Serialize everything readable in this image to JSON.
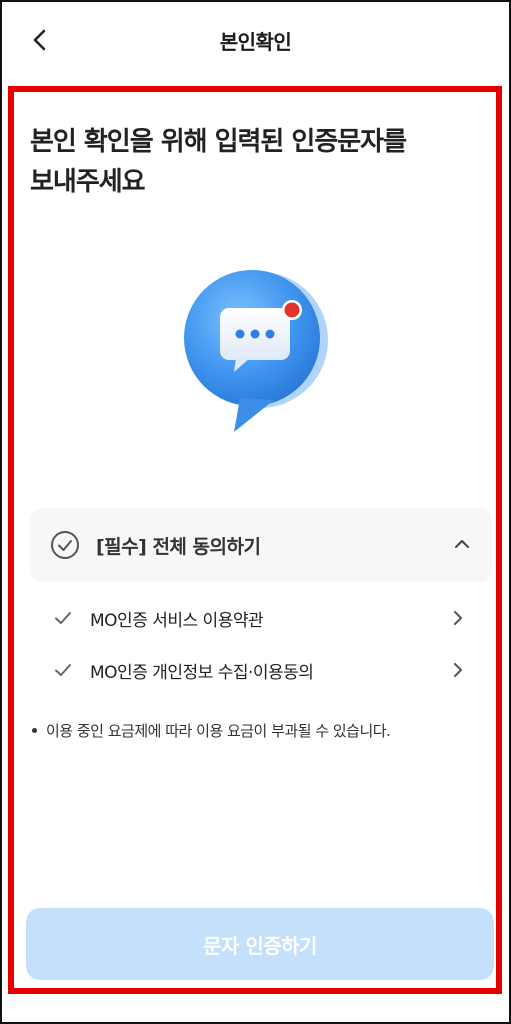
{
  "header": {
    "title": "본인확인",
    "back_icon": "chevron-left-icon"
  },
  "main": {
    "headline_line1": "본인 확인을 위해 입력된 인증문자를",
    "headline_line2": "보내주세요",
    "illustration_icon": "message-bubble-icon",
    "agree_all": {
      "label": "[필수] 전체 동의하기",
      "checked": false
    },
    "terms": [
      {
        "label": "MO인증 서비스 이용약관",
        "checked": true
      },
      {
        "label": "MO인증 개인정보 수집·이용동의",
        "checked": true
      }
    ],
    "notice": "이용 중인 요금제에 따라 이용 요금이 부과될 수 있습니다.",
    "submit_label": "문자 인증하기"
  },
  "colors": {
    "highlight_border": "#e80000",
    "button_disabled": "#c4e0fb",
    "bubble_blue": "#4a9cf0",
    "notification_dot": "#e5322d"
  }
}
